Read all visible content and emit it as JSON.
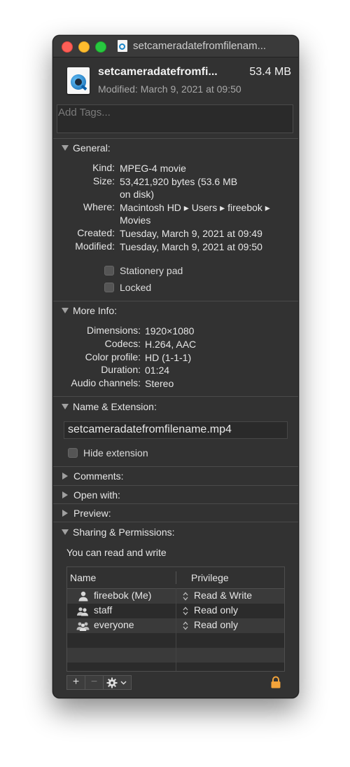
{
  "window": {
    "title": "setcameradatefromfilenam...",
    "file_name": "setcameradatefromfi...",
    "file_size": "53.4 MB",
    "modified_line": "Modified: March 9, 2021 at 09:50"
  },
  "tags": {
    "placeholder": "Add Tags..."
  },
  "general": {
    "title": "General:",
    "kind_label": "Kind:",
    "kind": "MPEG-4 movie",
    "size_label": "Size:",
    "size_line1": "53,421,920 bytes (53.6 MB",
    "size_line2": "on disk)",
    "where_label": "Where:",
    "where_line1": "Macintosh HD ▸ Users ▸ fireebok ▸",
    "where_line2": "Movies",
    "created_label": "Created:",
    "created": "Tuesday, March 9, 2021 at 09:49",
    "modified_label": "Modified:",
    "modified": "Tuesday, March 9, 2021 at 09:50",
    "stationery_label": "Stationery pad",
    "locked_label": "Locked"
  },
  "more_info": {
    "title": "More Info:",
    "dimensions_label": "Dimensions:",
    "dimensions": "1920×1080",
    "codecs_label": "Codecs:",
    "codecs": "H.264, AAC",
    "color_label": "Color profile:",
    "color": "HD (1-1-1)",
    "duration_label": "Duration:",
    "duration": "01:24",
    "audio_label": "Audio channels:",
    "audio": "Stereo"
  },
  "name_ext": {
    "title": "Name & Extension:",
    "filename": "setcameradatefromfilename.mp4",
    "hide_ext_label": "Hide extension"
  },
  "collapsed": {
    "comments": "Comments:",
    "open_with": "Open with:",
    "preview": "Preview:"
  },
  "sharing": {
    "title": "Sharing & Permissions:",
    "summary": "You can read and write",
    "col_name": "Name",
    "col_privilege": "Privilege",
    "rows": [
      {
        "name": "fireebok (Me)",
        "privilege": "Read & Write"
      },
      {
        "name": "staff",
        "privilege": "Read only"
      },
      {
        "name": "everyone",
        "privilege": "Read only"
      }
    ],
    "add_label": "+",
    "remove_label": "−"
  },
  "colors": {
    "window_bg": "#323232",
    "lock": "#f2a33a"
  }
}
